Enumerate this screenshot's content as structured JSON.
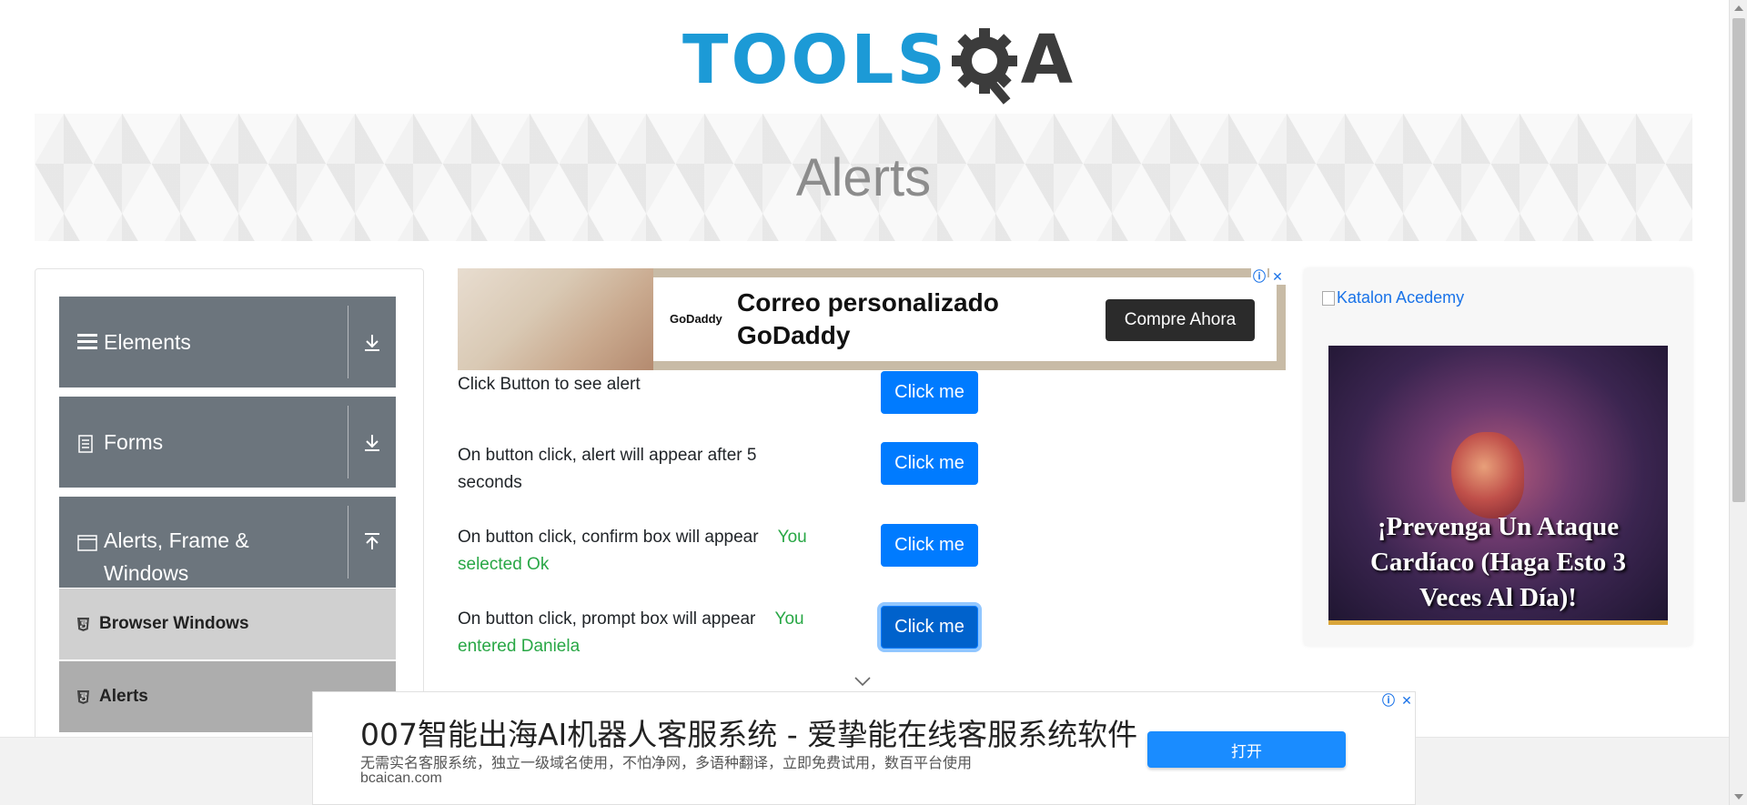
{
  "logo": {
    "part1": "TOOLS",
    "part3": "A",
    "colors": {
      "blue": "#1c9ad6",
      "dark": "#3c3c3c"
    }
  },
  "banner": {
    "title": "Alerts"
  },
  "sidebar": {
    "groups": [
      {
        "label": "Elements",
        "icon": "hamburger-icon",
        "arrow": "download-icon"
      },
      {
        "label": "Forms",
        "icon": "document-icon",
        "arrow": "download-icon"
      },
      {
        "label": "Alerts, Frame & Windows",
        "icon": "window-icon",
        "arrow": "upload-icon"
      }
    ],
    "subitems": [
      {
        "label": "Browser Windows",
        "icon": "html5-icon"
      },
      {
        "label": "Alerts",
        "icon": "html5-icon",
        "active": true
      }
    ]
  },
  "top_ad": {
    "brand": "GoDaddy",
    "headline": "Correo personalizado GoDaddy",
    "cta": "Compre Ahora"
  },
  "alerts": {
    "rows": [
      {
        "text": "Click Button to see alert",
        "result": "",
        "button": "Click me"
      },
      {
        "text": "On button click, alert will appear after 5 seconds",
        "result": "",
        "button": "Click me"
      },
      {
        "text": "On button click, confirm box will appear",
        "result": "You selected Ok",
        "button": "Click me"
      },
      {
        "text": "On button click, prompt box will appear",
        "result": "You entered Daniela",
        "button": "Click me"
      }
    ]
  },
  "right_ad": {
    "image_alt": "Katalon Acedemy",
    "headline": "¡Prevenga Un Ataque Cardíaco (Haga Esto 3 Veces Al Día)!"
  },
  "bottom_ad": {
    "title": "007智能出海AI机器人客服系统 - 爱挚能在线客服系统软件",
    "description": "无需实名客服系统，独立一级域名使用，不怕净网，多语种翻译，立即免费试用，数百平台使用",
    "domain": "bcaican.com",
    "cta": "打开"
  },
  "ad_choices": {
    "info": "ⓘ",
    "close": "✕"
  },
  "colors": {
    "primary": "#007bff",
    "success": "#28a745",
    "nav_gray": "#6c757d"
  }
}
